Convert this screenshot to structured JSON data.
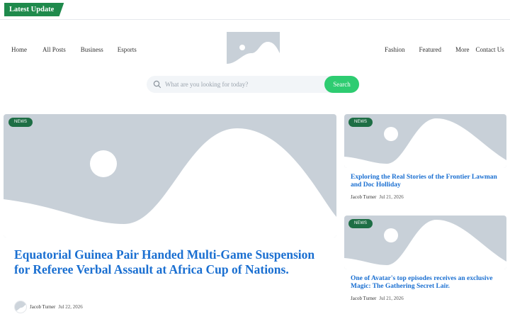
{
  "topbar": {
    "latest_label": "Latest Update"
  },
  "nav": {
    "left": [
      "Home",
      "All Posts",
      "Business",
      "Esports"
    ],
    "right": [
      "Fashion",
      "Featured",
      "More",
      "Contact Us"
    ]
  },
  "search": {
    "placeholder": "What are you looking for today?",
    "button": "Search"
  },
  "featured": {
    "badge": "NEWS",
    "title": "Equatorial Guinea Pair Handed Multi-Game Suspension for Referee Verbal Assault at Africa Cup of Nations.",
    "author": "Jacob Turner",
    "date": "Jul 22, 2026"
  },
  "side": [
    {
      "badge": "NEWS",
      "title": "Exploring the Real Stories of the Frontier Lawman and Doc Holliday",
      "author": "Jacob Turner",
      "date": "Jul 21, 2026"
    },
    {
      "badge": "NEWS",
      "title": "One of Avatar's top episodes receives an exclusive Magic: The Gathering Secret Lair.",
      "author": "Jacob Turner",
      "date": "Jul 21, 2026"
    }
  ],
  "colors": {
    "accent": "#2ecc71",
    "badge": "#1e6e45",
    "link": "#1a6fd1",
    "placeholder": "#c8d0d8"
  }
}
